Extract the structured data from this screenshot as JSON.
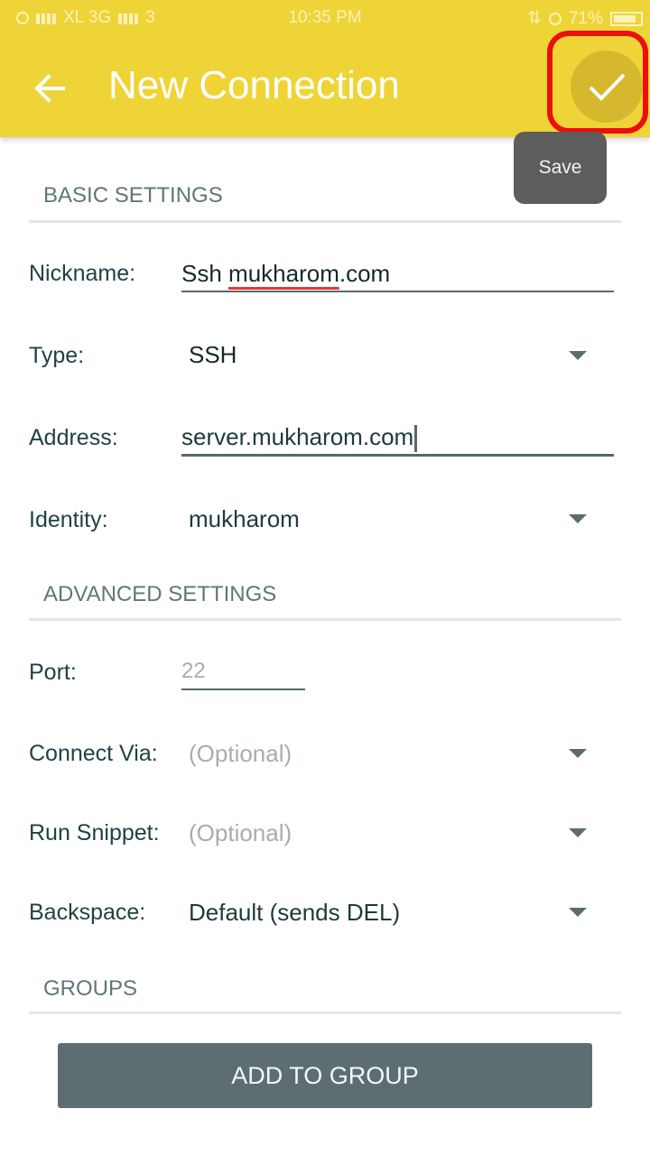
{
  "status_bar": {
    "carrier1": "XL 3G",
    "carrier2": "3",
    "time": "10:35 PM",
    "battery": "71%"
  },
  "app_bar": {
    "title": "New Connection",
    "back_icon": "arrow-back-icon",
    "save_icon": "check-icon",
    "save_tooltip": "Save",
    "highlight_color": "#ec0f0f",
    "background_color": "#eed437"
  },
  "basic_settings": {
    "header": "BASIC SETTINGS",
    "nickname": {
      "label": "Nickname:",
      "value_prefix": "Ssh ",
      "value_spell": "mukharom",
      "value_suffix": ".com"
    },
    "type": {
      "label": "Type:",
      "value": "SSH"
    },
    "address": {
      "label": "Address:",
      "value": "server.mukharom.com"
    },
    "identity": {
      "label": "Identity:",
      "value": "mukharom"
    }
  },
  "advanced_settings": {
    "header": "ADVANCED SETTINGS",
    "port": {
      "label": "Port:",
      "value": "22"
    },
    "connect_via": {
      "label": "Connect Via:",
      "placeholder": "(Optional)"
    },
    "run_snippet": {
      "label": "Run Snippet:",
      "placeholder": "(Optional)"
    },
    "backspace": {
      "label": "Backspace:",
      "value": "Default (sends DEL)"
    }
  },
  "groups": {
    "header": "GROUPS",
    "add_button": "ADD TO GROUP"
  }
}
